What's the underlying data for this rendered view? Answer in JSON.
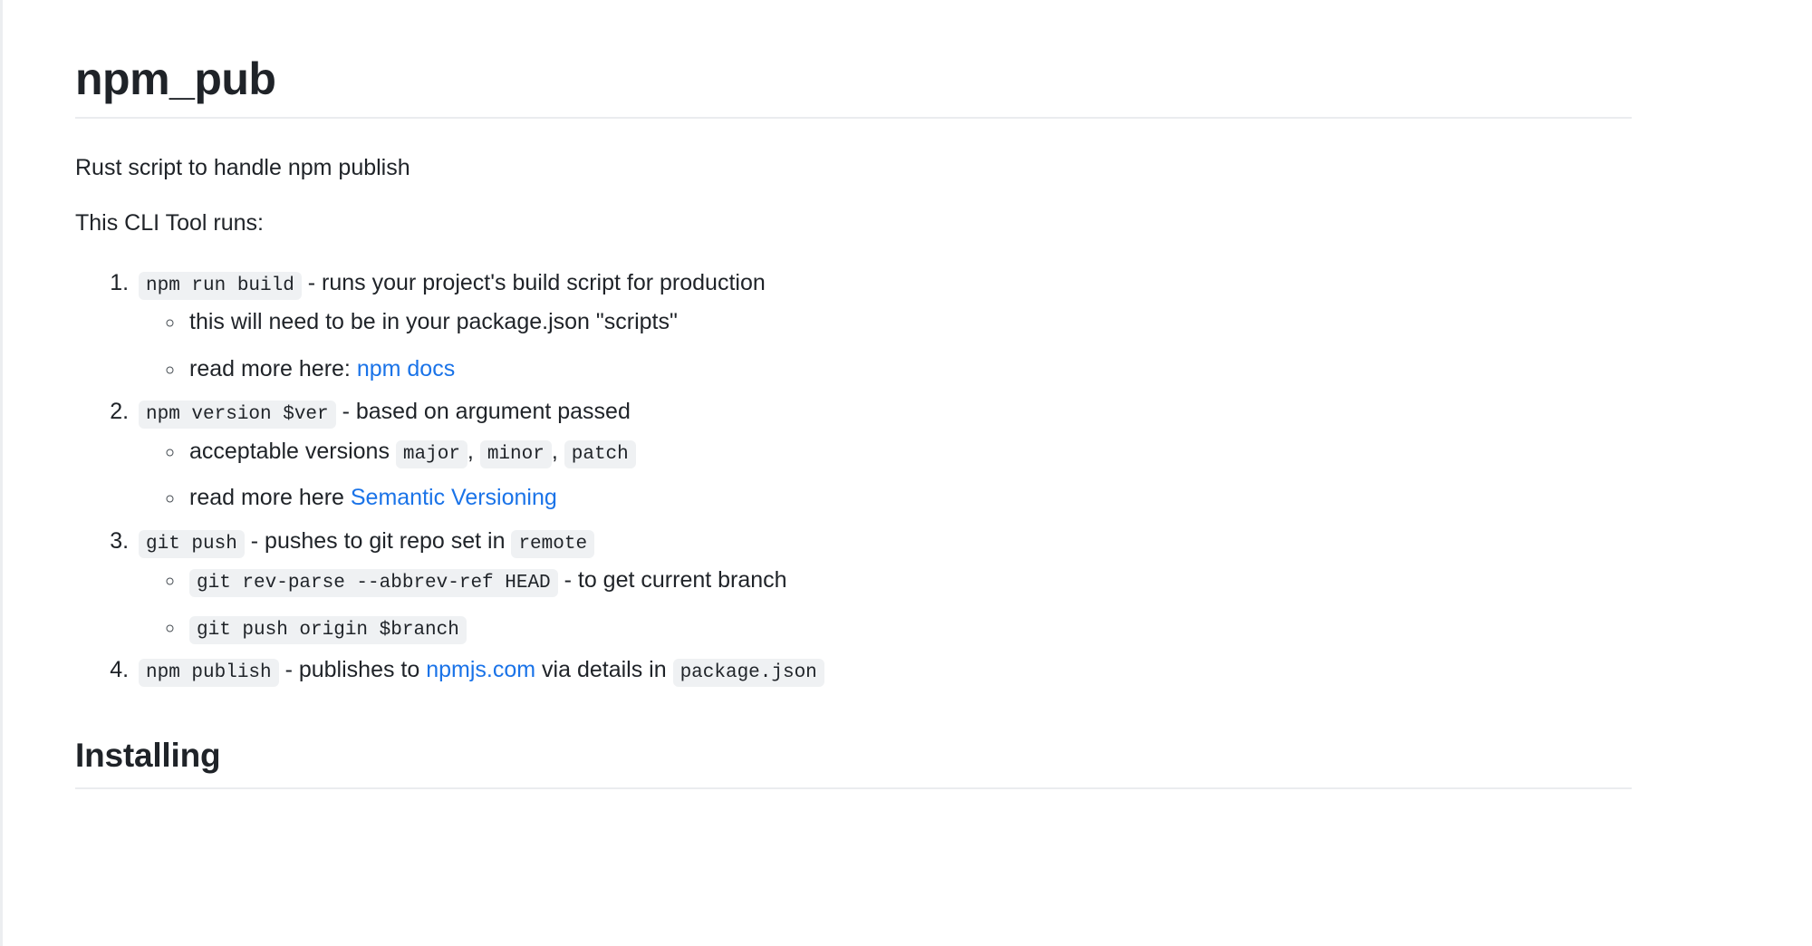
{
  "document": {
    "title": "npm_pub",
    "intro": "Rust script to handle npm publish",
    "lead": "This CLI Tool runs:",
    "section_heading": "Installing"
  },
  "steps": [
    {
      "code": "npm run build",
      "text": " - runs your project's build script for production",
      "substeps": [
        {
          "type": "text",
          "text": "this will need to be in your package.json \"scripts\""
        },
        {
          "type": "link",
          "before": "read more here: ",
          "link": "npm docs",
          "after": ""
        }
      ]
    },
    {
      "code": "npm version $ver",
      "text": " - based on argument passed",
      "substeps": [
        {
          "type": "codes",
          "before": "acceptable versions ",
          "code1": "major",
          "sep1": ",",
          "code2": "minor",
          "sep2": ",",
          "code3": "patch"
        },
        {
          "type": "link",
          "before": "read more here ",
          "link": "Semantic Versioning",
          "after": ""
        }
      ]
    },
    {
      "code": "git push",
      "text": " - pushes to git repo set in ",
      "trailing_code": "remote",
      "substeps": [
        {
          "type": "code-lead",
          "code": "git rev-parse --abbrev-ref HEAD",
          "text": " - to get current branch"
        },
        {
          "type": "code-only",
          "code": "git push origin $branch"
        }
      ]
    },
    {
      "code": "npm publish",
      "text_before_link": " - publishes to ",
      "link": "npmjs.com",
      "text_after_link": " via details in ",
      "trailing_code": "package.json",
      "substeps": []
    }
  ],
  "colors": {
    "link": "#1a73e8",
    "text": "#1f2328",
    "code_background": "#eff1f3",
    "rule": "#eaecef",
    "page_background": "#ffffff"
  }
}
